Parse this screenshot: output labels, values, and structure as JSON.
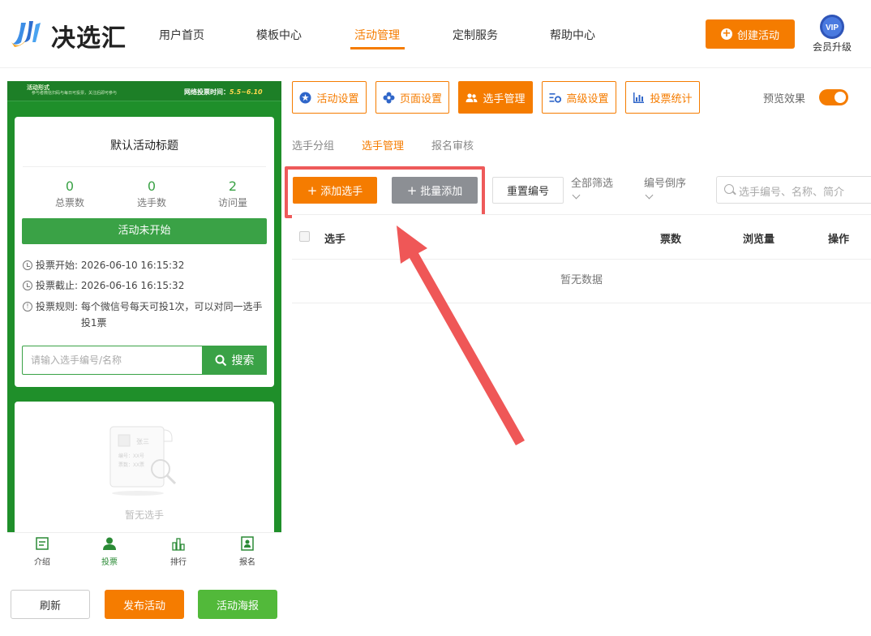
{
  "header": {
    "logo_text": "决选汇",
    "nav": [
      {
        "label": "用户首页",
        "active": false
      },
      {
        "label": "模板中心",
        "active": false
      },
      {
        "label": "活动管理",
        "active": true
      },
      {
        "label": "定制服务",
        "active": false
      },
      {
        "label": "帮助中心",
        "active": false
      }
    ],
    "create_button": "创建活动",
    "vip_badge": "VIP",
    "vip_label": "会员升级"
  },
  "phone": {
    "banner": {
      "left_title": "活动形式",
      "left_sub": "参与者微信扫码与每日可投票，关注后即可参与",
      "right_label": "网络投票时间：",
      "right_time": "5.5~6.10"
    },
    "card": {
      "title": "默认活动标题",
      "stats": [
        {
          "value": "0",
          "label": "总票数"
        },
        {
          "value": "0",
          "label": "选手数"
        },
        {
          "value": "2",
          "label": "访问量"
        }
      ],
      "status_button": "活动未开始",
      "start_label": "投票开始:",
      "start_time": "2026-06-10 16:15:32",
      "end_label": "投票截止:",
      "end_time": "2026-06-16 16:15:32",
      "rule_label": "投票规则:",
      "rule_text": "每个微信号每天可投1次，可以对同一选手投1票",
      "search_placeholder": "请输入选手编号/名称",
      "search_button": "搜索"
    },
    "empty": {
      "sample_name": "张三",
      "sample_no": "编号：XX号",
      "sample_votes": "票数：XX票",
      "text": "暂无选手"
    },
    "tabbar": [
      {
        "label": "介绍",
        "icon": "intro-icon"
      },
      {
        "label": "投票",
        "icon": "vote-user-icon"
      },
      {
        "label": "排行",
        "icon": "rank-icon"
      },
      {
        "label": "报名",
        "icon": "signup-icon"
      }
    ]
  },
  "bottom_buttons": {
    "refresh": "刷新",
    "publish": "发布活动",
    "poster": "活动海报"
  },
  "toolbar": {
    "items": [
      {
        "label": "活动设置",
        "icon": "star-icon",
        "active": false
      },
      {
        "label": "页面设置",
        "icon": "flower-gear-icon",
        "active": false
      },
      {
        "label": "选手管理",
        "icon": "users-icon",
        "active": true
      },
      {
        "label": "高级设置",
        "icon": "settings-list-icon",
        "active": false
      },
      {
        "label": "投票统计",
        "icon": "bar-chart-icon",
        "active": false
      }
    ],
    "preview_label": "预览效果",
    "preview_on": true
  },
  "subtabs": [
    {
      "label": "选手分组",
      "active": false
    },
    {
      "label": "选手管理",
      "active": true
    },
    {
      "label": "报名审核",
      "active": false
    }
  ],
  "actions": {
    "add": "添加选手",
    "batch_add": "批量添加",
    "reset_numbers": "重置编号",
    "filter": "全部筛选",
    "sort": "编号倒序",
    "search_placeholder": "选手编号、名称、简介"
  },
  "table": {
    "columns": [
      "选手",
      "票数",
      "浏览量",
      "操作"
    ],
    "empty_text": "暂无数据"
  },
  "colors": {
    "accent": "#f57c00",
    "phone_green": "#1f8f2a",
    "button_green": "#3aa246",
    "highlight_red": "#ee5a5a"
  }
}
